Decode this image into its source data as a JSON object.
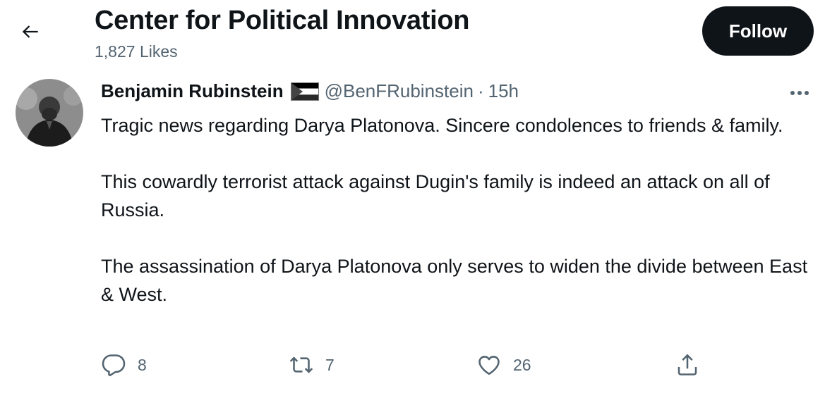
{
  "header": {
    "title": "Center for Political Innovation",
    "likes": "1,827 Likes",
    "follow_label": "Follow"
  },
  "tweet": {
    "author_name": "Benjamin Rubinstein",
    "handle": "@BenFRubinstein",
    "separator": "·",
    "time": "15h",
    "paragraphs": [
      "Tragic news regarding Darya Platonova. Sincere condolences to friends & family.",
      "This cowardly terrorist attack against Dugin's family is indeed an attack on all of Russia.",
      "The assassination of Darya Platonova only serves to widen the divide between East & West."
    ],
    "stats": {
      "replies": "8",
      "retweets": "7",
      "likes": "26"
    }
  },
  "icons": {
    "back": "arrow-left-icon",
    "flag": "palestine-flag-icon",
    "more": "more-horizontal-icon",
    "reply": "reply-icon",
    "retweet": "retweet-icon",
    "like": "heart-icon",
    "share": "share-icon"
  },
  "colors": {
    "text": "#0f1419",
    "secondary": "#536471",
    "follow_bg": "#0f1419"
  }
}
